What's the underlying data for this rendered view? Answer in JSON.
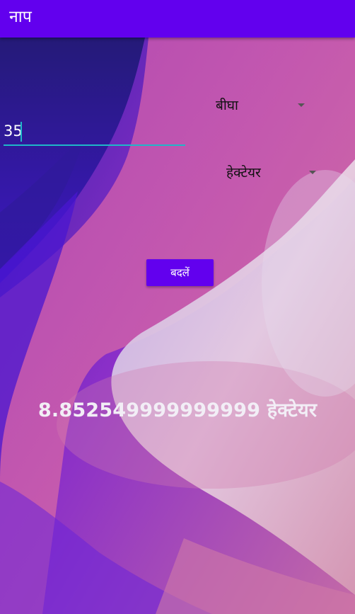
{
  "app_bar": {
    "title": "नाप"
  },
  "from_unit": {
    "selected": "बीघा",
    "icon": "dropdown-arrow-icon"
  },
  "amount_input": {
    "value": "35"
  },
  "to_unit": {
    "selected": "हेक्टेयर",
    "icon": "dropdown-arrow-icon"
  },
  "convert_button": {
    "label": "बदलें"
  },
  "result": {
    "text": "8.852549999999999 हेक्टेयर"
  },
  "colors": {
    "primary": "#6200ee",
    "accent": "#1fb7c8",
    "result_text": "#f2eef6"
  }
}
